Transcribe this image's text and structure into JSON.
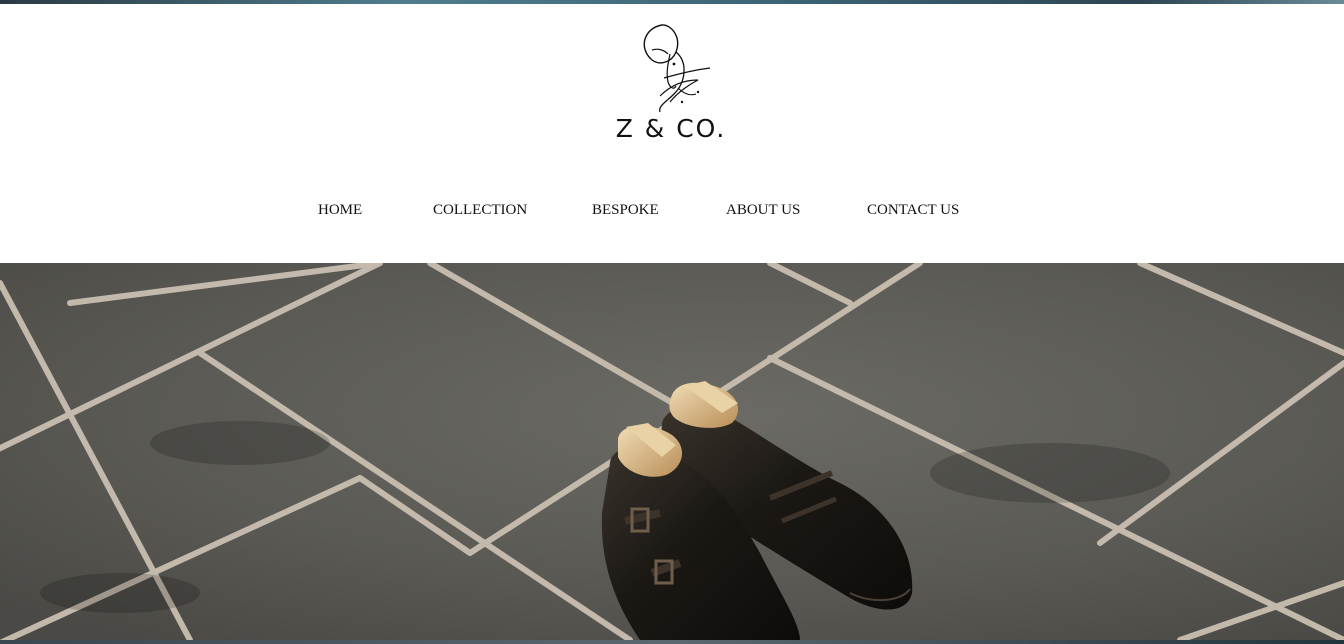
{
  "brand": {
    "name": "Z & CO.",
    "logo_icon": "monogram-sketch-icon"
  },
  "nav": {
    "items": [
      {
        "label": "HOME"
      },
      {
        "label": "COLLECTION"
      },
      {
        "label": "BESPOKE"
      },
      {
        "label": "ABOUT US"
      },
      {
        "label": "CONTACT US"
      }
    ]
  },
  "hero": {
    "subject": "shoes-on-tile-image",
    "colors": {
      "tile": "#5e5d58",
      "grout": "#c8bfb2",
      "leather": "#1d1915",
      "shoe_tree": "#d9b98a"
    }
  },
  "colors": {
    "text": "#111111",
    "background": "#ffffff"
  }
}
